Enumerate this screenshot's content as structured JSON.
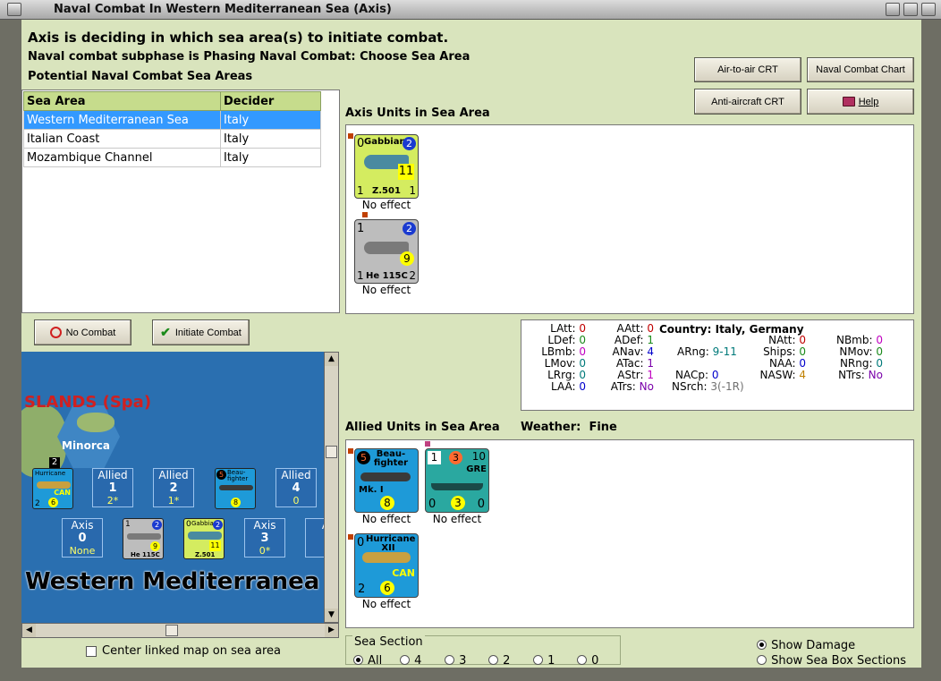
{
  "window": {
    "title": "Naval Combat In Western Mediterranean Sea (Axis)"
  },
  "header": {
    "line1": "Axis is deciding in which sea area(s) to initiate combat.",
    "line2": "Naval combat subphase is Phasing Naval Combat: Choose Sea Area",
    "line3": "Potential Naval Combat Sea Areas"
  },
  "buttons": {
    "air_to_air": "Air-to-air CRT",
    "naval_chart": "Naval Combat Chart",
    "anti_aircraft": "Anti-aircraft CRT",
    "help": "Help",
    "no_combat": "No Combat",
    "initiate": "Initiate Combat"
  },
  "sea_table": {
    "headers": [
      "Sea Area",
      "Decider"
    ],
    "rows": [
      [
        "Western Mediterranean Sea",
        "Italy"
      ],
      [
        "Italian Coast",
        "Italy"
      ],
      [
        "Mozambique Channel",
        "Italy"
      ]
    ]
  },
  "axis_section": {
    "title": "Axis Units in Sea Area",
    "units": [
      {
        "name": "Gabbiano",
        "model": "Z.501",
        "tl": "0",
        "tr": "2",
        "mid": "11",
        "bl": "1",
        "br": "1",
        "effect": "No effect"
      },
      {
        "name": "",
        "model": "He 115C",
        "tl": "1",
        "tr": "2",
        "mid": "9",
        "bl": "1",
        "br": "2",
        "effect": "No effect"
      }
    ]
  },
  "stats": {
    "col1": [
      [
        "LAtt:",
        "0"
      ],
      [
        "LDef:",
        "0"
      ],
      [
        "LBmb:",
        "0"
      ],
      [
        "LMov:",
        "0"
      ],
      [
        "LRrg:",
        "0"
      ],
      [
        "LAA:",
        "0"
      ]
    ],
    "col2": [
      [
        "AAtt:",
        "0"
      ],
      [
        "ADef:",
        "1"
      ],
      [
        "ANav:",
        "4"
      ],
      [
        "ATac:",
        "1"
      ],
      [
        "AStr:",
        "1"
      ],
      [
        "ATrs:",
        "No"
      ]
    ],
    "country_label": "Country:",
    "country": "Italy, Germany",
    "arng_label": "ARng:",
    "arng": "9-11",
    "nacp_label": "NACp:",
    "nacp": "0",
    "nsrch_label": "NSrch:",
    "nsrch": "3(-1R)",
    "col4": [
      [
        "NAtt:",
        "0"
      ],
      [
        "Ships:",
        "0"
      ],
      [
        "NAA:",
        "0"
      ],
      [
        "NASW:",
        "4"
      ]
    ],
    "col5": [
      [
        "NBmb:",
        "0"
      ],
      [
        "NMov:",
        "0"
      ],
      [
        "NRng:",
        "0"
      ],
      [
        "NTrs:",
        "No"
      ]
    ]
  },
  "allied_section": {
    "title": "Allied Units in Sea Area",
    "weather_label": "Weather:",
    "weather": "Fine",
    "units": [
      {
        "name": "Beau-fighter",
        "model": "Mk. I",
        "tl": "5",
        "mid": "8",
        "effect": "No effect"
      },
      {
        "name": "GRE",
        "tl": "1",
        "t2": "3",
        "tr": "10",
        "b1": "0",
        "mid": "3",
        "b3": "0",
        "effect": "No effect"
      },
      {
        "name": "Hurricane XII",
        "model": "CAN",
        "tl": "0",
        "mid": "6",
        "bl": "2",
        "effect": "No effect"
      }
    ]
  },
  "map": {
    "islands_label": "SLANDS (Spa)",
    "minorca": "Minorca",
    "sea_label": "Western Mediterranea",
    "allied_boxes": [
      {
        "t": "Allied",
        "n": "1",
        "s": "2*"
      },
      {
        "t": "Allied",
        "n": "2",
        "s": "1*"
      },
      {
        "t": "Allied",
        "n": "4",
        "s": "0"
      }
    ],
    "axis_boxes": [
      {
        "t": "Axis",
        "n": "0",
        "s": "None"
      },
      {
        "t": "Axis",
        "n": "3",
        "s": "0*"
      },
      {
        "t": "A",
        "n": "",
        "s": ""
      }
    ],
    "mini_hurricane": {
      "tag": "2",
      "name": "Hurricane",
      "sub": "CAN",
      "a": "2",
      "b": "6"
    },
    "mini_beau": {
      "tag": "5",
      "name": "Beau-fighter",
      "mid": "8"
    },
    "mini_he": {
      "a": "1",
      "b": "2",
      "c": "9",
      "model": "He 115C"
    },
    "mini_gab": {
      "a": "0",
      "b": "2",
      "c": "11",
      "name": "Gabbiano",
      "model": "Z.501"
    }
  },
  "center_map": {
    "label": "Center linked map on sea area",
    "checked": false
  },
  "sea_section": {
    "title": "Sea Section",
    "options": [
      "All",
      "4",
      "3",
      "2",
      "1",
      "0"
    ],
    "selected": "All"
  },
  "display": {
    "show_damage": "Show Damage",
    "show_sections": "Show Sea Box Sections",
    "selected": "show_damage"
  },
  "colors": {
    "panel_bg": "#d9e4bd",
    "header_green": "#c6dc8c",
    "selection": "#3399ff",
    "sea": "#2a6fb0"
  }
}
